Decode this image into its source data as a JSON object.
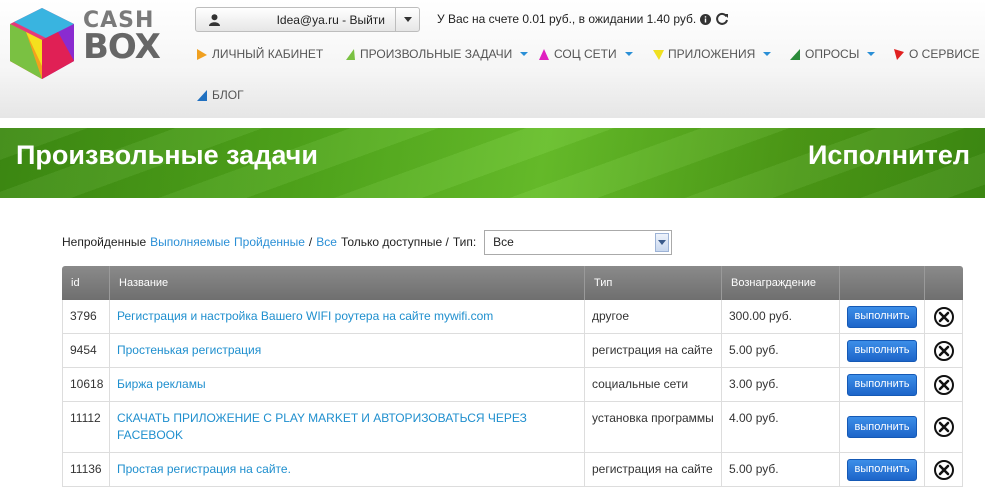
{
  "logo": {
    "line1": "CASH",
    "line2": "BOX"
  },
  "user": {
    "label": "Idea@ya.ru - Выйти"
  },
  "balance": {
    "text": "У Вас на счете 0.01 руб., в ожидании 1.40 руб."
  },
  "nav": [
    {
      "label": "ЛИЧНЫЙ КАБИНЕТ",
      "color": "#f0a020",
      "dropdown": false
    },
    {
      "label": "ПРОИЗВОЛЬНЫЕ ЗАДАЧИ",
      "color": "#7ac142",
      "dropdown": true
    },
    {
      "label": "СОЦ СЕТИ",
      "color": "#e020c0",
      "dropdown": true
    },
    {
      "label": "ПРИЛОЖЕНИЯ",
      "color": "#f0e020",
      "dropdown": true
    },
    {
      "label": "ОПРОСЫ",
      "color": "#2a8a3a",
      "dropdown": true
    },
    {
      "label": "О СЕРВИСЕ",
      "color": "#e02020",
      "dropdown": true
    },
    {
      "label": "БЛОГ",
      "color": "#2070c0",
      "dropdown": false
    }
  ],
  "banner": {
    "title": "Произвольные задачи",
    "title2": "Исполнител"
  },
  "filter": {
    "unpassed": "Непройденные",
    "active": "Выполняемые",
    "passed": "Пройденные",
    "slash": "/",
    "all": "Все",
    "only_available": "Только доступные /",
    "type_label": "Тип:",
    "type_value": "Все"
  },
  "table": {
    "headers": {
      "id": "id",
      "name": "Название",
      "type": "Тип",
      "reward": "Вознаграждение"
    },
    "button_label": "выполнить",
    "rows": [
      {
        "id": "3796",
        "name": "Регистрация и настройка Вашего WIFI роутера на сайте mywifi.com",
        "type": "другое",
        "reward": "300.00 руб."
      },
      {
        "id": "9454",
        "name": "Простенькая регистрация",
        "type": "регистрация на сайте",
        "reward": "5.00 руб."
      },
      {
        "id": "10618",
        "name": "Биржа рекламы",
        "type": "социальные сети",
        "reward": "3.00 руб."
      },
      {
        "id": "11112",
        "name": "СКАЧАТЬ ПРИЛОЖЕНИЕ С PLAY MARKET И АВТОРИЗОВАТЬСЯ ЧЕРЕЗ FACEBOOK",
        "type": "установка программы",
        "reward": "4.00 руб."
      },
      {
        "id": "11136",
        "name": "Простая регистрация на сайте.",
        "type": "регистрация на сайте",
        "reward": "5.00 руб."
      }
    ]
  },
  "icons": {
    "user": "user-icon",
    "caret": "caret-down-icon",
    "info": "info-icon",
    "refresh": "refresh-icon",
    "close": "close-circle-icon"
  }
}
